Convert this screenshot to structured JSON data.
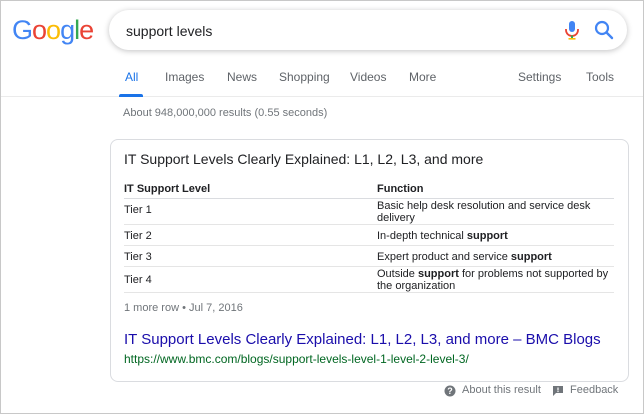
{
  "logo": {
    "letters": [
      "G",
      "o",
      "o",
      "g",
      "l",
      "e"
    ],
    "colors": [
      "#4285F4",
      "#EA4335",
      "#FBBC05",
      "#4285F4",
      "#34A853",
      "#EA4335"
    ]
  },
  "search": {
    "query": "support levels",
    "mic_icon": "mic-icon",
    "search_icon": "search-icon"
  },
  "tabs": {
    "all": "All",
    "images": "Images",
    "news": "News",
    "shopping": "Shopping",
    "videos": "Videos",
    "more": "More",
    "settings": "Settings",
    "tools": "Tools",
    "active": "All"
  },
  "result_stats": "About 948,000,000 results (0.55 seconds)",
  "snippet": {
    "title": "IT Support Levels Clearly Explained: L1, L2, L3, and more",
    "table": {
      "headers": [
        "IT Support Level",
        "Function"
      ],
      "rows": [
        {
          "level": "Tier 1",
          "function": "Basic help desk resolution and service desk delivery"
        },
        {
          "level": "Tier 2",
          "function_pre": "In-depth technical ",
          "function_bold": "support",
          "function_post": ""
        },
        {
          "level": "Tier 3",
          "function_pre": "Expert product and service ",
          "function_bold": "support",
          "function_post": ""
        },
        {
          "level": "Tier 4",
          "function_pre": "Outside ",
          "function_bold": "support",
          "function_post": " for problems not supported by the organization"
        }
      ]
    },
    "more_row": "1 more row",
    "separator": "•",
    "date": "Jul 7, 2016",
    "link_title": "IT Support Levels Clearly Explained: L1, L2, L3, and more – BMC Blogs",
    "url": "https://www.bmc.com/blogs/support-levels-level-1-level-2-level-3/"
  },
  "footer": {
    "about": "About this result",
    "feedback": "Feedback"
  },
  "colors": {
    "link": "#1a0dab",
    "url": "#006621",
    "accent": "#1a73e8",
    "muted": "#70757a"
  }
}
